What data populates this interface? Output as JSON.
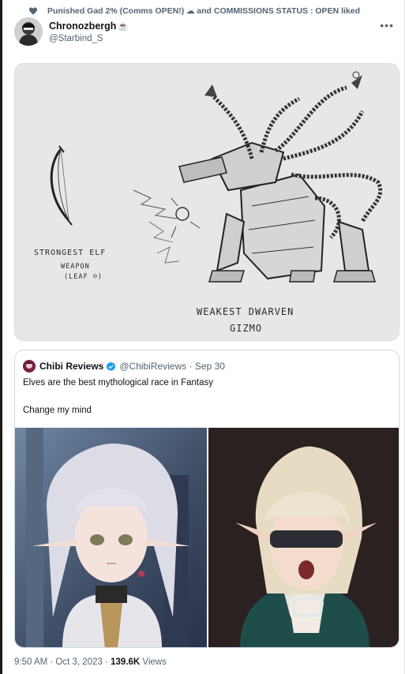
{
  "social_context": {
    "text": "Punished Gad 2% (Comms OPEN!)",
    "cloud_glyph": "☁",
    "rest": "and COMMISSIONS STATUS : OPEN liked",
    "icon": "heart-icon"
  },
  "author": {
    "name": "Chronozbergh",
    "emoji": "☕",
    "handle": "@Starbind_S"
  },
  "more_icon": "•••",
  "sketch": {
    "label_elf": "STRONGEST ELF",
    "label_weapon": "WEAPON",
    "label_leaf": "(LEAF ☺)",
    "label_dwarf_1": "WEAKEST DWARVEN",
    "label_dwarf_2": "GIZMO"
  },
  "quote": {
    "name": "Chibi Reviews",
    "meta": "@ChibiReviews · Sep 30",
    "text_1": "Elves are the best mythological race in Fantasy",
    "text_2": "Change my mind"
  },
  "footer": {
    "time_date": "9:50 AM · Oct 3, 2023 · ",
    "views_count": "139.6K",
    "views_label": " Views"
  },
  "colors": {
    "accent_verified": "#1d9bf0",
    "muted_text": "#536471",
    "primary_text": "#0f1419"
  }
}
